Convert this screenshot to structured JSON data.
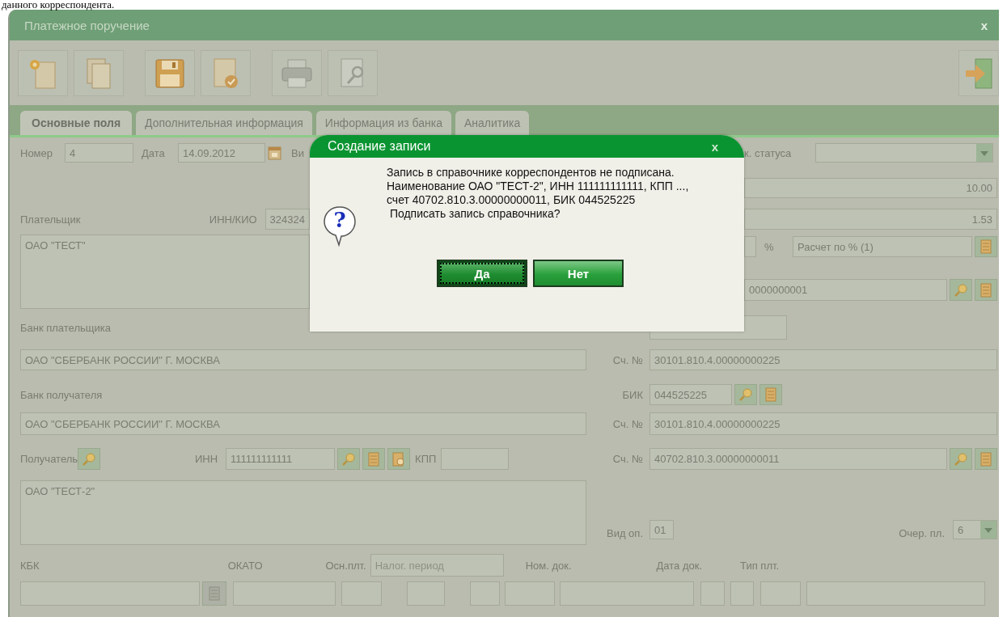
{
  "document_text": "данного корреспондента.",
  "window": {
    "title": "Платежное поручение",
    "close": "x"
  },
  "tabs": [
    {
      "label": "Основные поля",
      "selected": true
    },
    {
      "label": "Дополнительная информация",
      "selected": false
    },
    {
      "label": "Информация из банка",
      "selected": false
    },
    {
      "label": "Аналитика",
      "selected": false
    }
  ],
  "header": {
    "number_label": "Номер",
    "number": "4",
    "date_label": "Дата",
    "date": "14.09.2012",
    "type_label": "Ви",
    "status_label": "к. статуса",
    "amount": "10.00",
    "vat": "1.53",
    "vat_unit": "%",
    "vat_method": "Расчет по % (1)",
    "payer_account": "0000000001"
  },
  "payer": {
    "label": "Плательщик",
    "inn_label": "ИНН/КИО",
    "inn": "324324",
    "name": "ОАО \"ТЕСТ\""
  },
  "payer_bank": {
    "label": "Банк плательщика",
    "name": "ОАО \"СБЕРБАНК РОССИИ\" Г. МОСКВА",
    "account_label": "Сч. №",
    "account": "30101.810.4.00000000225"
  },
  "payee_bank": {
    "label": "Банк получателя",
    "bik_label": "БИК",
    "bik": "044525225",
    "name": "ОАО \"СБЕРБАНК РОССИИ\" Г. МОСКВА",
    "account_label": "Сч. №",
    "account": "30101.810.4.00000000225"
  },
  "payee": {
    "label": "Получатель",
    "inn_label": "ИНН",
    "inn": "111111111111",
    "kpp_label": "КПП",
    "account_label": "Сч. №",
    "account": "40702.810.3.00000000011",
    "name": "ОАО \"ТЕСТ-2\""
  },
  "operation": {
    "label": "Вид оп.",
    "value": "01"
  },
  "priority": {
    "label": "Очер. пл.",
    "value": "6"
  },
  "tax": {
    "kbk_label": "КБК",
    "okato_label": "ОКАТО",
    "basis_label": "Осн.плт.",
    "period_placeholder": "Налог. период",
    "doc_number_label": "Ном. док.",
    "doc_date_label": "Дата док.",
    "type_label": "Тип плт."
  },
  "dialog": {
    "title": "Создание записи",
    "close": "x",
    "icon_glyph": "?",
    "message": [
      "Запись в справочнике корреспондентов не подписана.",
      "Наименование ОАО \"ТЕСТ-2\", ИНН 111111111111, КПП ..., счет 40702.810.3.00000000011, БИК 044525225",
      " Подписать запись справочника?"
    ],
    "buttons": [
      {
        "label": "Да",
        "focused": true
      },
      {
        "label": "Нет",
        "focused": false
      }
    ]
  }
}
